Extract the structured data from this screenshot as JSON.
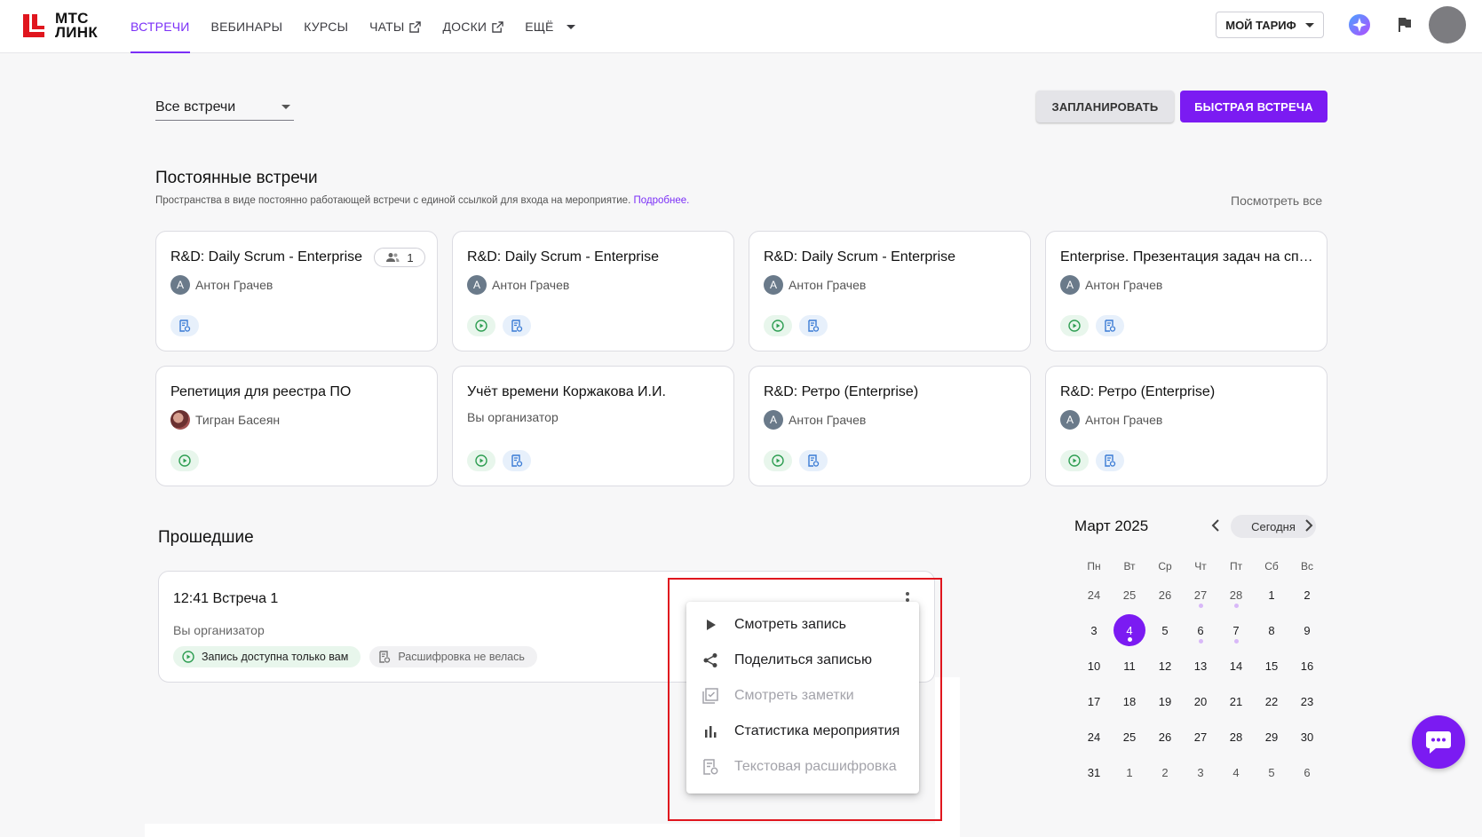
{
  "header": {
    "logo_text_line1": "МТС",
    "logo_text_line2": "ЛИНК",
    "nav": [
      {
        "label": "ВСТРЕЧИ"
      },
      {
        "label": "ВЕБИНАРЫ"
      },
      {
        "label": "КУРСЫ"
      },
      {
        "label": "ЧАТЫ"
      },
      {
        "label": "ДОСКИ"
      },
      {
        "label": "ЕЩЁ"
      }
    ],
    "tariff_label": "МОЙ ТАРИФ"
  },
  "toolbar": {
    "filter_value": "Все встречи",
    "plan_label": "ЗАПЛАНИРОВАТЬ",
    "quick_label": "БЫСТРАЯ ВСТРЕЧА"
  },
  "permanent": {
    "title": "Постоянные встречи",
    "subtitle": "Пространства в виде постоянно работающей встречи с единой ссылкой для входа на мероприятие.",
    "more_link": "Подробнее.",
    "see_all": "Посмотреть все",
    "cards": [
      {
        "title": "R&D: Daily Scrum - Enterprise",
        "owner": "Антон Грачев",
        "avatar_letter": "А",
        "participants": "1"
      },
      {
        "title": "R&D: Daily Scrum - Enterprise",
        "owner": "Антон Грачев",
        "avatar_letter": "А"
      },
      {
        "title": "R&D: Daily Scrum - Enterprise",
        "owner": "Антон Грачев",
        "avatar_letter": "А"
      },
      {
        "title": "Enterprise. Презентация задач на спринт",
        "owner": "Антон Грачев",
        "avatar_letter": "А"
      },
      {
        "title": "Репетиция для реестра ПО",
        "owner": "Тигран Басеян"
      },
      {
        "title": "Учёт времени Коржакова И.И.",
        "owner": "Вы организатор"
      },
      {
        "title": "R&D: Ретро (Enterprise)",
        "owner": "Антон Грачев",
        "avatar_letter": "А"
      },
      {
        "title": "R&D: Ретро (Enterprise)",
        "owner": "Антон Грачев",
        "avatar_letter": "А"
      }
    ]
  },
  "past": {
    "title": "Прошедшие",
    "meeting": {
      "time_title": "12:41  Встреча 1",
      "organizer": "Вы организатор",
      "recording_tag": "Запись доступна только вам",
      "transcript_tag": "Расшифровка не велась"
    }
  },
  "context_menu": {
    "items": [
      {
        "label": "Смотреть запись",
        "icon": "play-icon",
        "disabled": false
      },
      {
        "label": "Поделиться записью",
        "icon": "share-icon",
        "disabled": false
      },
      {
        "label": "Смотреть заметки",
        "icon": "notes-icon",
        "disabled": true
      },
      {
        "label": "Статистика мероприятия",
        "icon": "bar-chart-icon",
        "disabled": false
      },
      {
        "label": "Текстовая расшифровка",
        "icon": "transcript-icon",
        "disabled": true
      }
    ]
  },
  "calendar": {
    "month": "Март 2025",
    "today_label": "Сегодня",
    "weekdays": [
      "Пн",
      "Вт",
      "Ср",
      "Чт",
      "Пт",
      "Сб",
      "Вс"
    ],
    "weeks": [
      [
        "24",
        "25",
        "26",
        "27",
        "28",
        "1",
        "2"
      ],
      [
        "3",
        "4",
        "5",
        "6",
        "7",
        "8",
        "9"
      ],
      [
        "10",
        "11",
        "12",
        "13",
        "14",
        "15",
        "16"
      ],
      [
        "17",
        "18",
        "19",
        "20",
        "21",
        "22",
        "23"
      ],
      [
        "24",
        "25",
        "26",
        "27",
        "28",
        "29",
        "30"
      ],
      [
        "31",
        "1",
        "2",
        "3",
        "4",
        "5",
        "6"
      ]
    ],
    "selected_day": "4"
  },
  "colors": {
    "accent": "#7b1bf2",
    "brand_red": "#e0161e"
  }
}
